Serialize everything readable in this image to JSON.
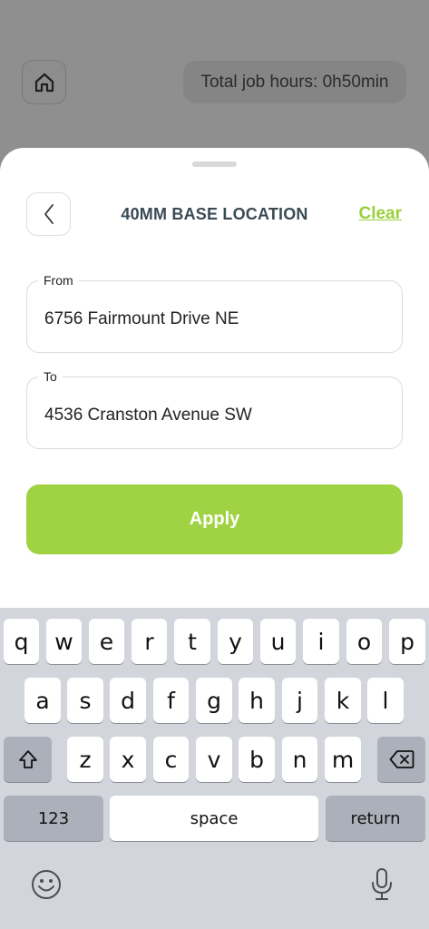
{
  "header": {
    "home_icon": "home-icon",
    "total_hours": "Total job hours: 0h50min"
  },
  "sheet": {
    "title": "40MM BASE LOCATION",
    "clear_label": "Clear",
    "back_icon": "chevron-left-icon",
    "from_label": "From",
    "from_value": "6756 Fairmount Drive NE",
    "to_label": "To",
    "to_value": "4536 Cranston Avenue SW",
    "apply_label": "Apply",
    "accent_color": "#a0d343"
  },
  "keyboard": {
    "row1": [
      "q",
      "w",
      "e",
      "r",
      "t",
      "y",
      "u",
      "i",
      "o",
      "p"
    ],
    "row2": [
      "a",
      "s",
      "d",
      "f",
      "g",
      "h",
      "j",
      "k",
      "l"
    ],
    "row3": [
      "z",
      "x",
      "c",
      "v",
      "b",
      "n",
      "m"
    ],
    "shift_icon": "shift-icon",
    "delete_icon": "delete-icon",
    "numbers_label": "123",
    "space_label": "space",
    "return_label": "return",
    "emoji_icon": "emoji-icon",
    "mic_icon": "microphone-icon"
  }
}
